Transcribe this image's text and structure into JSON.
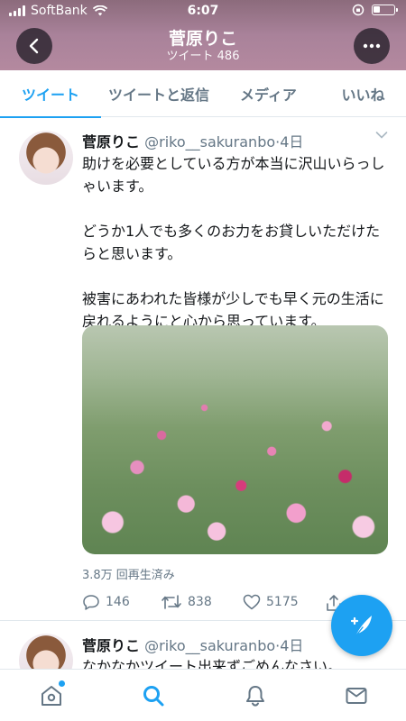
{
  "status_bar": {
    "carrier": "SoftBank",
    "time": "6:07",
    "battery_level": 0.35
  },
  "header": {
    "title": "菅原りこ",
    "subtitle": "ツイート 486",
    "back_icon": "chevron-left-icon",
    "more_icon": "more-horizontal-icon"
  },
  "tabs": [
    {
      "label": "ツイート",
      "active": true
    },
    {
      "label": "ツイートと返信",
      "active": false
    },
    {
      "label": "メディア",
      "active": false
    },
    {
      "label": "いいね",
      "active": false
    }
  ],
  "tweets": [
    {
      "name": "菅原りこ",
      "handle": "@riko__sakuranbo",
      "time": "·4日",
      "text": "助けを必要としている方が本当に沢山いらっしゃいます。\n\nどうか1人でも多くのお力をお貸しいただけたらと思います。\n\n被害にあわれた皆様が少しでも早く元の生活に戻れるようにと心から思っています。",
      "views": "3.8万 回再生済み",
      "replies": "146",
      "retweets": "838",
      "likes": "5175"
    },
    {
      "name": "菅原りこ",
      "handle": "@riko__sakuranbo",
      "time": "·4日",
      "text": "なかなかツイート出来ずごめんなさい。"
    }
  ],
  "nav": [
    "home-icon",
    "search-icon",
    "notifications-icon",
    "messages-icon"
  ],
  "colors": {
    "accent": "#1da1f2",
    "header_bg": "#a9829a",
    "secondary_text": "#657786"
  }
}
